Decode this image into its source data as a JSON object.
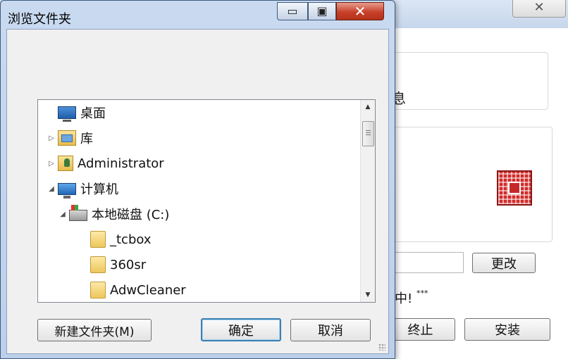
{
  "background_window": {
    "close_glyph": "✕",
    "info_text_partial": "息",
    "change_button": "更改",
    "status_text_partial": "中!",
    "status_stars": "***",
    "stop_button_partial": "终止",
    "install_button": "安装",
    "accent_color": "#d22b2b"
  },
  "dialog": {
    "title": "浏览文件夹",
    "min_glyph": "▭",
    "max_glyph": "▣",
    "close_glyph": "✕",
    "tree": [
      {
        "label": "桌面",
        "icon": "desktop-icon",
        "arrow": "",
        "indent": 0
      },
      {
        "label": "库",
        "icon": "library-icon",
        "arrow": "▷",
        "indent": 0
      },
      {
        "label": "Administrator",
        "icon": "user-folder-icon",
        "arrow": "▷",
        "indent": 0
      },
      {
        "label": "计算机",
        "icon": "computer-icon",
        "arrow": "◢",
        "indent": 0
      },
      {
        "label": "本地磁盘 (C:)",
        "icon": "local-disk-icon",
        "arrow": "◢",
        "indent": 1
      },
      {
        "label": "_tcbox",
        "icon": "folder-icon",
        "arrow": "",
        "indent": 2
      },
      {
        "label": "360sr",
        "icon": "folder-icon",
        "arrow": "",
        "indent": 2
      },
      {
        "label": "AdwCleaner",
        "icon": "folder-icon",
        "arrow": "",
        "indent": 2
      }
    ],
    "new_folder_button": "新建文件夹(M)",
    "ok_button": "确定",
    "cancel_button": "取消"
  }
}
